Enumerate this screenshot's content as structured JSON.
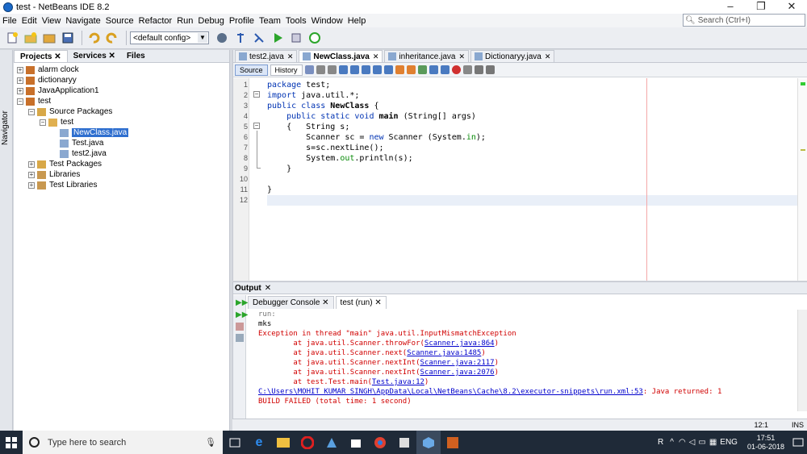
{
  "window": {
    "title": "test - NetBeans IDE 8.2",
    "min": "–",
    "max": "❐",
    "close": "✕"
  },
  "menu": [
    "File",
    "Edit",
    "View",
    "Navigate",
    "Source",
    "Refactor",
    "Run",
    "Debug",
    "Profile",
    "Team",
    "Tools",
    "Window",
    "Help"
  ],
  "search": {
    "placeholder": "Search (Ctrl+I)"
  },
  "toolbar": {
    "config": "<default config>"
  },
  "navigator": {
    "label": "Navigator"
  },
  "projects": {
    "tabs": [
      "Projects",
      "Services",
      "Files"
    ],
    "tree": [
      {
        "label": "alarm clock",
        "level": 0,
        "exp": "+",
        "icon": "project"
      },
      {
        "label": "dictionaryy",
        "level": 0,
        "exp": "+",
        "icon": "project"
      },
      {
        "label": "JavaApplication1",
        "level": 0,
        "exp": "+",
        "icon": "project"
      },
      {
        "label": "test",
        "level": 0,
        "exp": "−",
        "icon": "project"
      },
      {
        "label": "Source Packages",
        "level": 1,
        "exp": "−",
        "icon": "folder"
      },
      {
        "label": "test",
        "level": 2,
        "exp": "−",
        "icon": "package"
      },
      {
        "label": "NewClass.java",
        "level": 3,
        "exp": "",
        "icon": "java",
        "selected": true
      },
      {
        "label": "Test.java",
        "level": 3,
        "exp": "",
        "icon": "java"
      },
      {
        "label": "test2.java",
        "level": 3,
        "exp": "",
        "icon": "java"
      },
      {
        "label": "Test Packages",
        "level": 1,
        "exp": "+",
        "icon": "folder"
      },
      {
        "label": "Libraries",
        "level": 1,
        "exp": "+",
        "icon": "lib"
      },
      {
        "label": "Test Libraries",
        "level": 1,
        "exp": "+",
        "icon": "lib"
      }
    ]
  },
  "editor": {
    "tabs": [
      {
        "label": "test2.java",
        "active": false
      },
      {
        "label": "NewClass.java",
        "active": true
      },
      {
        "label": "inheritance.java",
        "active": false
      },
      {
        "label": "Dictionaryy.java",
        "active": false
      }
    ],
    "modes": [
      "Source",
      "History"
    ],
    "lines": [
      {
        "n": "1",
        "html": "<span class='kw'>package</span> test;"
      },
      {
        "n": "2",
        "html": "<span class='kw'>import</span> java.util.*;"
      },
      {
        "n": "3",
        "html": "<span class='kw'>public class</span> <span class='bold'>NewClass</span> {"
      },
      {
        "n": "4",
        "html": "    <span class='kw'>public static void</span> <span class='bold'>main</span> (String[] args)"
      },
      {
        "n": "5",
        "html": "    {   String s;"
      },
      {
        "n": "6",
        "html": "        Scanner sc = <span class='kw'>new</span> Scanner (System.<span class='fld'>in</span>);"
      },
      {
        "n": "7",
        "html": "        s=sc.nextLine();"
      },
      {
        "n": "8",
        "html": "        System.<span class='fld'>out</span>.println(s);"
      },
      {
        "n": "9",
        "html": "    }"
      },
      {
        "n": "10",
        "html": ""
      },
      {
        "n": "11",
        "html": "}"
      },
      {
        "n": "12",
        "html": ""
      }
    ]
  },
  "output": {
    "title": "Output",
    "tabs": [
      {
        "label": "Debugger Console",
        "active": false
      },
      {
        "label": "test (run)",
        "active": true
      }
    ],
    "lines": [
      {
        "cls": "gray",
        "t": "run:"
      },
      {
        "cls": "",
        "t": "mks"
      },
      {
        "cls": "err",
        "t": "Exception in thread \"main\" java.util.InputMismatchException"
      },
      {
        "cls": "err",
        "t": "        at java.util.Scanner.throwFor(",
        "link": "Scanner.java:864",
        "tail": ")"
      },
      {
        "cls": "err",
        "t": "        at java.util.Scanner.next(",
        "link": "Scanner.java:1485",
        "tail": ")"
      },
      {
        "cls": "err",
        "t": "        at java.util.Scanner.nextInt(",
        "link": "Scanner.java:2117",
        "tail": ")"
      },
      {
        "cls": "err",
        "t": "        at java.util.Scanner.nextInt(",
        "link": "Scanner.java:2076",
        "tail": ")"
      },
      {
        "cls": "err",
        "t": "        at test.Test.main(",
        "link": "Test.java:12",
        "tail": ")"
      },
      {
        "cls": "err",
        "t": "",
        "link": "C:\\Users\\MOHIT KUMAR SINGH\\AppData\\Local\\NetBeans\\Cache\\8.2\\executor-snippets\\run.xml:53",
        "tail": ": Java returned: 1"
      },
      {
        "cls": "err",
        "t": "BUILD FAILED (total time: 1 second)"
      }
    ]
  },
  "status": {
    "position": "12:1",
    "mode": "INS"
  },
  "taskbar": {
    "search": "Type here to search",
    "time": "17:51",
    "date": "01-06-2018",
    "lang": "ENG"
  }
}
